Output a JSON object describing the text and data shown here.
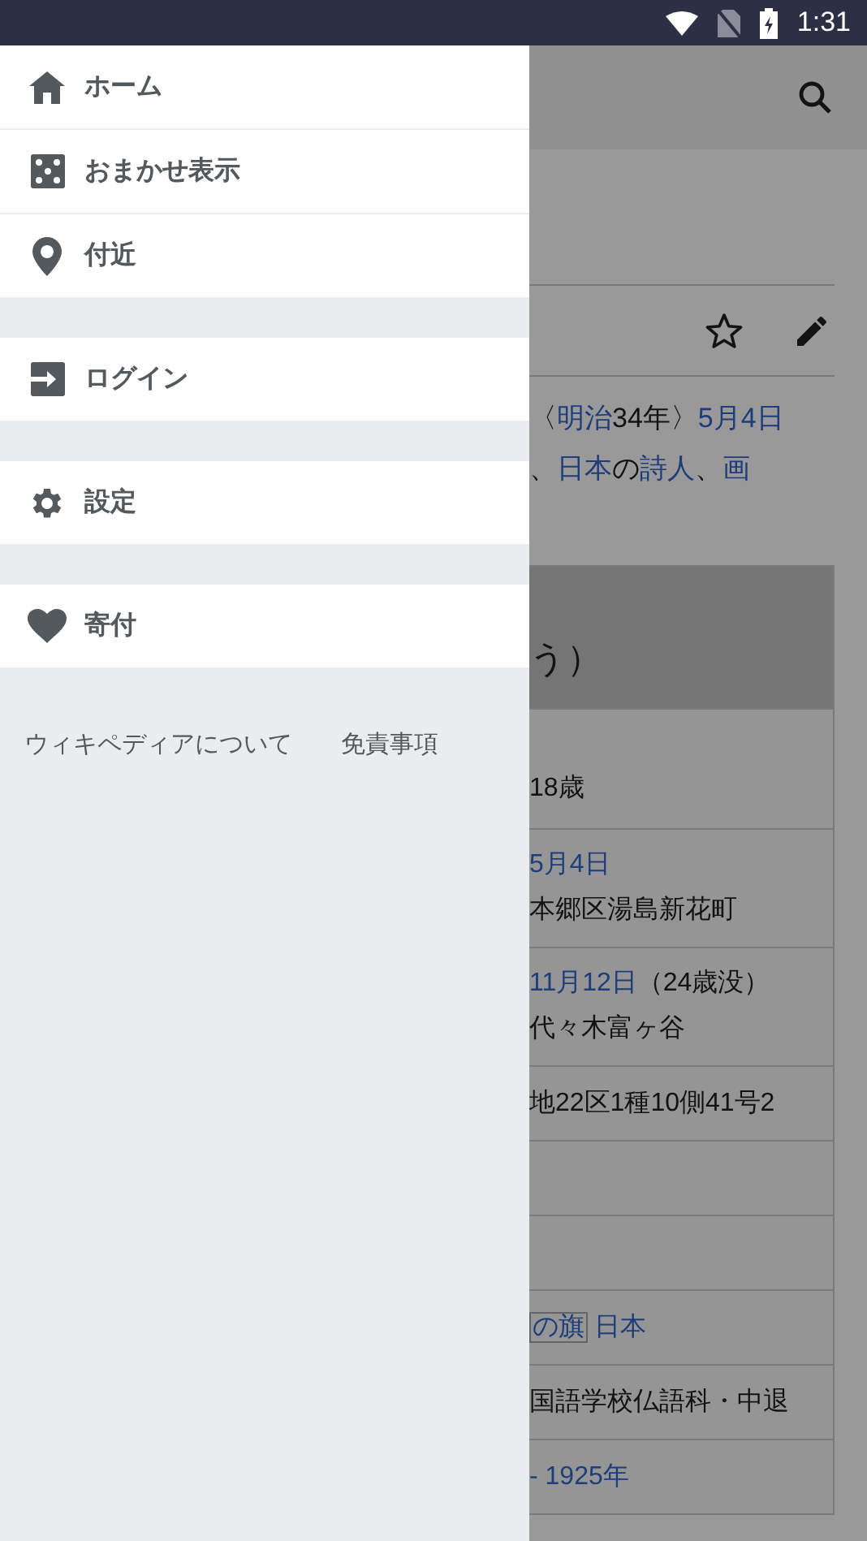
{
  "status_bar": {
    "time": "1:31"
  },
  "drawer": {
    "groups": [
      [
        {
          "label": "ホーム"
        },
        {
          "label": "おまかせ表示"
        },
        {
          "label": "付近"
        }
      ],
      [
        {
          "label": "ログイン"
        }
      ],
      [
        {
          "label": "設定"
        }
      ],
      [
        {
          "label": "寄付"
        }
      ]
    ],
    "footer_links": [
      "ウィキペディアについて",
      "免責事項"
    ]
  },
  "article": {
    "intro_lines": [
      [
        {
          "text": "〈",
          "kind": "text"
        },
        {
          "text": "明治",
          "kind": "link"
        },
        {
          "text": "34年〉",
          "kind": "text"
        },
        {
          "text": "5月4日",
          "kind": "link"
        }
      ],
      [
        {
          "text": "、",
          "kind": "text"
        },
        {
          "text": "日本",
          "kind": "link"
        },
        {
          "text": "の",
          "kind": "text"
        },
        {
          "text": "詩人",
          "kind": "link"
        },
        {
          "text": "、",
          "kind": "text"
        },
        {
          "text": "画",
          "kind": "link"
        }
      ]
    ],
    "infobox": {
      "title": "う）",
      "rows": [
        {
          "kind": "lines",
          "lines": [
            [
              {
                "text": "18歳",
                "kind": "text"
              }
            ]
          ]
        },
        {
          "kind": "lines",
          "lines": [
            [
              {
                "text": "5月4日",
                "kind": "link"
              }
            ],
            [
              {
                "text": "本郷区湯島新花町",
                "kind": "text"
              }
            ]
          ]
        },
        {
          "kind": "lines",
          "lines": [
            [
              {
                "text": "11月12日",
                "kind": "link"
              },
              {
                "text": "（24歳没）",
                "kind": "text"
              }
            ],
            [
              {
                "text": "代々木富ヶ谷",
                "kind": "text"
              }
            ]
          ]
        },
        {
          "kind": "lines",
          "lines": [
            [
              {
                "text": "地22区1種10側41号2",
                "kind": "text"
              }
            ]
          ]
        },
        {
          "kind": "blank"
        },
        {
          "kind": "blank"
        },
        {
          "kind": "lines",
          "lines": [
            [
              {
                "text": "の旗",
                "kind": "flag"
              },
              {
                "text": "日本",
                "kind": "link"
              }
            ]
          ]
        },
        {
          "kind": "lines",
          "lines": [
            [
              {
                "text": "国語学校仏語科・中退",
                "kind": "text"
              }
            ]
          ]
        },
        {
          "kind": "lines",
          "lines": [
            [
              {
                "text": "- 1925年",
                "kind": "link"
              }
            ]
          ]
        }
      ]
    }
  }
}
